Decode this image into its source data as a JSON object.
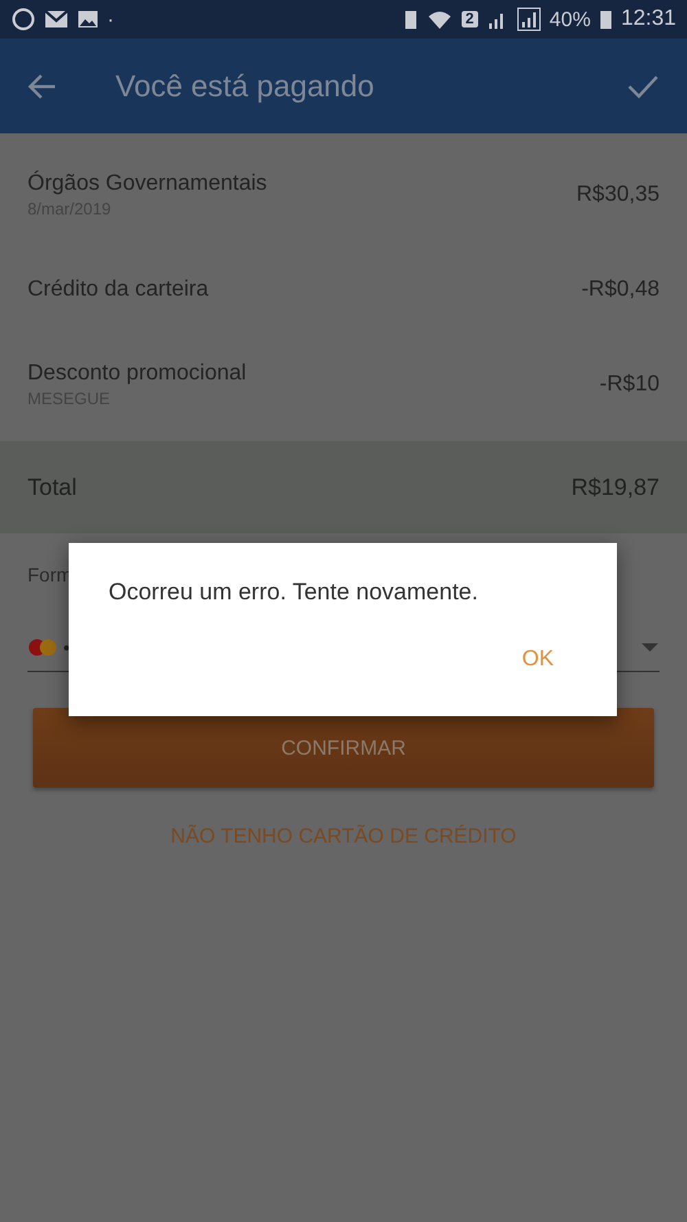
{
  "status_bar": {
    "battery_percent": "40%",
    "time": "12:31",
    "sim_badge": "2",
    "dot": "·"
  },
  "app_bar": {
    "title": "Você está pagando"
  },
  "items": [
    {
      "label": "Órgãos Governamentais",
      "sublabel": "8/mar/2019",
      "amount": "R$30,35"
    },
    {
      "label": "Crédito da carteira",
      "amount": "-R$0,48"
    },
    {
      "label": "Desconto promocional",
      "sublabel": "MESEGUE",
      "amount": "-R$10"
    }
  ],
  "total": {
    "label": "Total",
    "amount": "R$19,87"
  },
  "payment": {
    "label": "Form",
    "card_mask": "•"
  },
  "confirm_button": "CONFIRMAR",
  "no_card_link": "NÃO TENHO CARTÃO DE CRÉDITO",
  "dialog": {
    "message": "Ocorreu um erro. Tente novamente.",
    "button": "OK"
  }
}
